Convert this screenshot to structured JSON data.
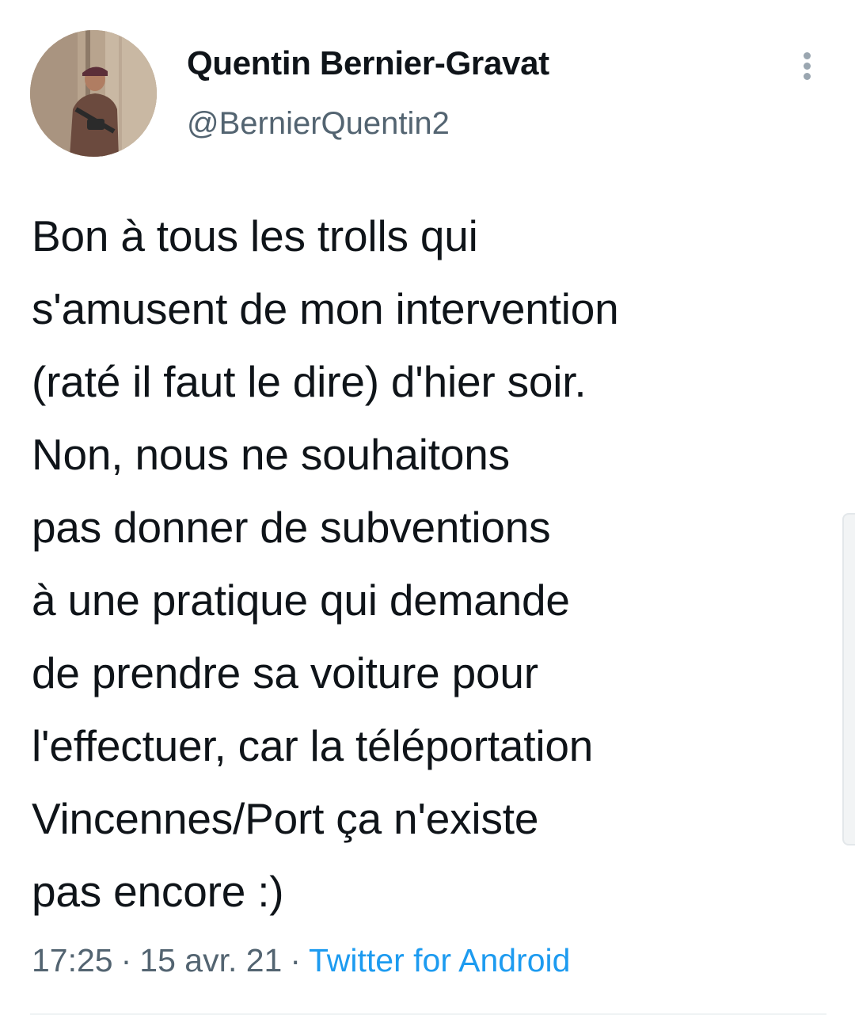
{
  "user": {
    "display_name": "Quentin Bernier-Gravat",
    "handle": "@BernierQuentin2"
  },
  "tweet": {
    "lines": [
      "Bon à tous les trolls qui",
      "s'amusent de mon intervention",
      "(raté il faut le dire) d'hier soir.",
      "Non, nous ne souhaitons",
      "pas donner de subventions",
      "à une pratique qui demande",
      "de prendre sa voiture pour",
      "l'effectuer, car la téléportation",
      "Vincennes/Port ça n'existe",
      "pas encore :)"
    ],
    "time": "17:25",
    "separator": "·",
    "date": "15 avr. 21",
    "source": "Twitter for Android"
  },
  "icons": {
    "more": "more-vertical-icon",
    "avatar": "profile-photo"
  },
  "colors": {
    "text": "#0f1419",
    "secondary": "#536471",
    "link": "#1d9bf0"
  }
}
